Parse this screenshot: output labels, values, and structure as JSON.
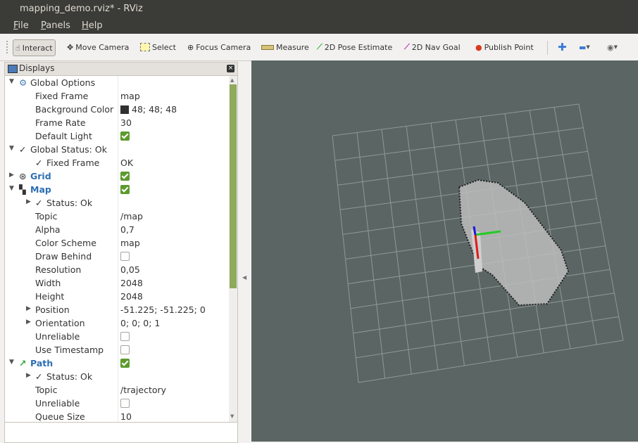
{
  "window": {
    "title": "mapping_demo.rviz* - RViz"
  },
  "menu": [
    "File",
    "Panels",
    "Help"
  ],
  "toolbar": {
    "interact": "Interact",
    "move_camera": "Move Camera",
    "select": "Select",
    "focus_camera": "Focus Camera",
    "measure": "Measure",
    "pose_estimate": "2D Pose Estimate",
    "nav_goal": "2D Nav Goal",
    "publish_point": "Publish Point"
  },
  "displays": {
    "title": "Displays",
    "rows": [
      {
        "label": "Global Options",
        "value": "",
        "kind": "group-open",
        "icon": "gear-icon"
      },
      {
        "label": "Fixed Frame",
        "value": "map"
      },
      {
        "label": "Background Color",
        "value": "48; 48; 48",
        "swatch": "#303030"
      },
      {
        "label": "Frame Rate",
        "value": "30"
      },
      {
        "label": "Default Light",
        "checked": true
      },
      {
        "label": "Global Status: Ok",
        "kind": "group-open",
        "icon": "check-icon"
      },
      {
        "label": "Fixed Frame",
        "value": "OK",
        "icon": "check-icon"
      },
      {
        "label": "Grid",
        "kind": "group-closed",
        "icon": "grid-icon",
        "blue": true,
        "checked": true
      },
      {
        "label": "Map",
        "kind": "group-open",
        "icon": "map-icon",
        "blue": true,
        "checked": true
      },
      {
        "label": "Status: Ok",
        "kind": "group-closed-sub",
        "icon": "check-icon"
      },
      {
        "label": "Topic",
        "value": "/map"
      },
      {
        "label": "Alpha",
        "value": "0,7"
      },
      {
        "label": "Color Scheme",
        "value": "map"
      },
      {
        "label": "Draw Behind",
        "checked": false
      },
      {
        "label": "Resolution",
        "value": "0,05"
      },
      {
        "label": "Width",
        "value": "2048"
      },
      {
        "label": "Height",
        "value": "2048"
      },
      {
        "label": "Position",
        "value": "-51.225; -51.225; 0",
        "kind": "group-closed-sub"
      },
      {
        "label": "Orientation",
        "value": "0; 0; 0; 1",
        "kind": "group-closed-sub"
      },
      {
        "label": "Unreliable",
        "checked": false
      },
      {
        "label": "Use Timestamp",
        "checked": false
      },
      {
        "label": "Path",
        "kind": "group-open",
        "icon": "path-icon",
        "blue": true,
        "checked": true
      },
      {
        "label": "Status: Ok",
        "kind": "group-closed-sub",
        "icon": "check-icon"
      },
      {
        "label": "Topic",
        "value": "/trajectory"
      },
      {
        "label": "Unreliable",
        "checked": false
      },
      {
        "label": "Queue Size",
        "value": "10"
      }
    ]
  },
  "colors": {
    "view_bg": "#5b6664",
    "accent": "#5d9a2e",
    "link": "#2c6fb3"
  }
}
